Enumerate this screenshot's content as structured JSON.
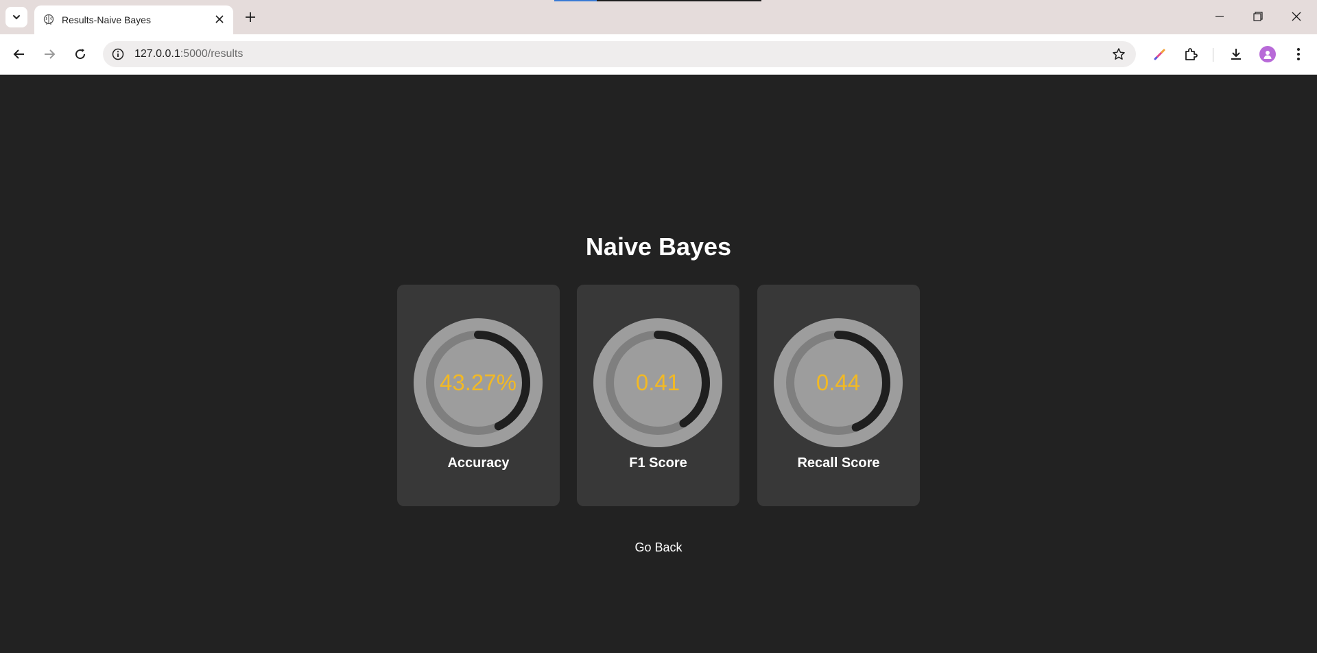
{
  "browser": {
    "tab_title": "Results-Naive Bayes",
    "url_host": "127.0.0.1",
    "url_path": ":5000/results"
  },
  "page": {
    "title": "Naive Bayes",
    "metrics": [
      {
        "label": "Accuracy",
        "value_text": "43.27%",
        "fraction": 0.43
      },
      {
        "label": "F1 Score",
        "value_text": "0.41",
        "fraction": 0.41
      },
      {
        "label": "Recall Score",
        "value_text": "0.44",
        "fraction": 0.44
      }
    ],
    "go_back_label": "Go Back"
  },
  "colors": {
    "background": "#222222",
    "card": "#383838",
    "value_text": "#f2b924",
    "gauge_outer": "#9d9d9d",
    "gauge_track": "#7f7f7f",
    "gauge_progress": "#1f1f1f"
  },
  "icons": [
    "tab-list-icon",
    "brain-favicon-icon",
    "close-icon",
    "plus-icon",
    "minimize-icon",
    "restore-icon",
    "back-icon",
    "forward-icon",
    "reload-icon",
    "site-info-icon",
    "star-icon",
    "pen-icon",
    "extensions-icon",
    "download-icon",
    "profile-avatar",
    "more-icon"
  ]
}
